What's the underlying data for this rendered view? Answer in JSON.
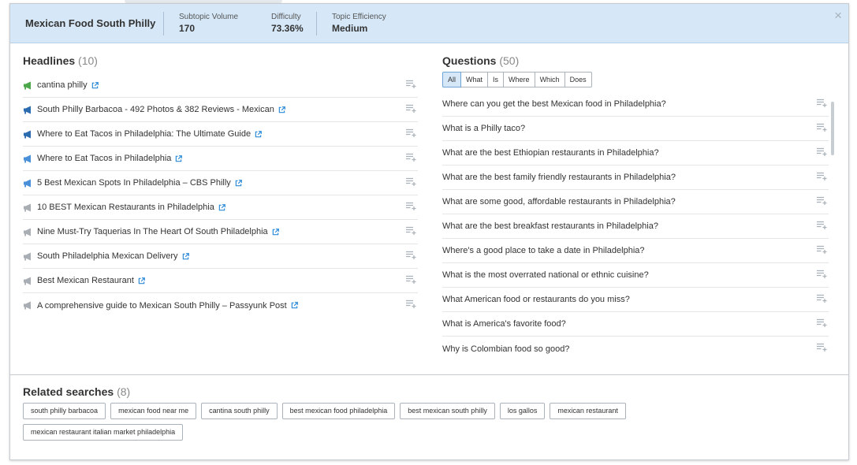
{
  "header": {
    "title": "Mexican Food South Philly",
    "subtopic_volume_label": "Subtopic Volume",
    "subtopic_volume_value": "170",
    "difficulty_label": "Difficulty",
    "difficulty_value": "73.36%",
    "topic_efficiency_label": "Topic Efficiency",
    "topic_efficiency_value": "Medium",
    "close_symbol": "×"
  },
  "headlines": {
    "title": "Headlines",
    "count": "(10)",
    "items": [
      {
        "text": "cantina philly",
        "icon_color": "#4aa84a"
      },
      {
        "text": "South Philly Barbacoa - 492 Photos & 382 Reviews - Mexican",
        "icon_color": "#2b6cb0"
      },
      {
        "text": "Where to Eat Tacos in Philadelphia: The Ultimate Guide",
        "icon_color": "#2b6cb0"
      },
      {
        "text": "Where to Eat Tacos in Philadelphia",
        "icon_color": "#4a90d9"
      },
      {
        "text": "5 Best Mexican Spots In Philadelphia – CBS Philly",
        "icon_color": "#4a90d9"
      },
      {
        "text": "10 BEST Mexican Restaurants in Philadelphia",
        "icon_color": "#a8aeb4"
      },
      {
        "text": "Nine Must-Try Taquerias In The Heart Of South Philadelphia",
        "icon_color": "#a8aeb4"
      },
      {
        "text": "South Philadelphia Mexican Delivery",
        "icon_color": "#a8aeb4"
      },
      {
        "text": "Best Mexican Restaurant",
        "icon_color": "#a8aeb4"
      },
      {
        "text": "A comprehensive guide to Mexican South Philly – Passyunk Post",
        "icon_color": "#a8aeb4"
      }
    ]
  },
  "questions": {
    "title": "Questions",
    "count": "(50)",
    "filters": [
      "All",
      "What",
      "Is",
      "Where",
      "Which",
      "Does"
    ],
    "active_filter": "All",
    "items": [
      "Where can you get the best Mexican food in Philadelphia?",
      "What is a Philly taco?",
      "What are the best Ethiopian restaurants in Philadelphia?",
      "What are the best family friendly restaurants in Philadelphia?",
      "What are some good, affordable restaurants in Philadelphia?",
      "What are the best breakfast restaurants in Philadelphia?",
      "Where's a good place to take a date in Philadelphia?",
      "What is the most overrated national or ethnic cuisine?",
      "What American food or restaurants do you miss?",
      "What is America's favorite food?",
      "Why is Colombian food so good?"
    ]
  },
  "related": {
    "title": "Related searches",
    "count": "(8)",
    "tags": [
      "south philly barbacoa",
      "mexican food near me",
      "cantina south philly",
      "best mexican food philadelphia",
      "best mexican south philly",
      "los gallos",
      "mexican restaurant",
      "mexican restaurant italian market philadelphia"
    ]
  },
  "colors": {
    "header_bg": "#d6e8f8",
    "link_icon": "#2b8ad8",
    "active_filter_bg": "#d6e8f8"
  }
}
